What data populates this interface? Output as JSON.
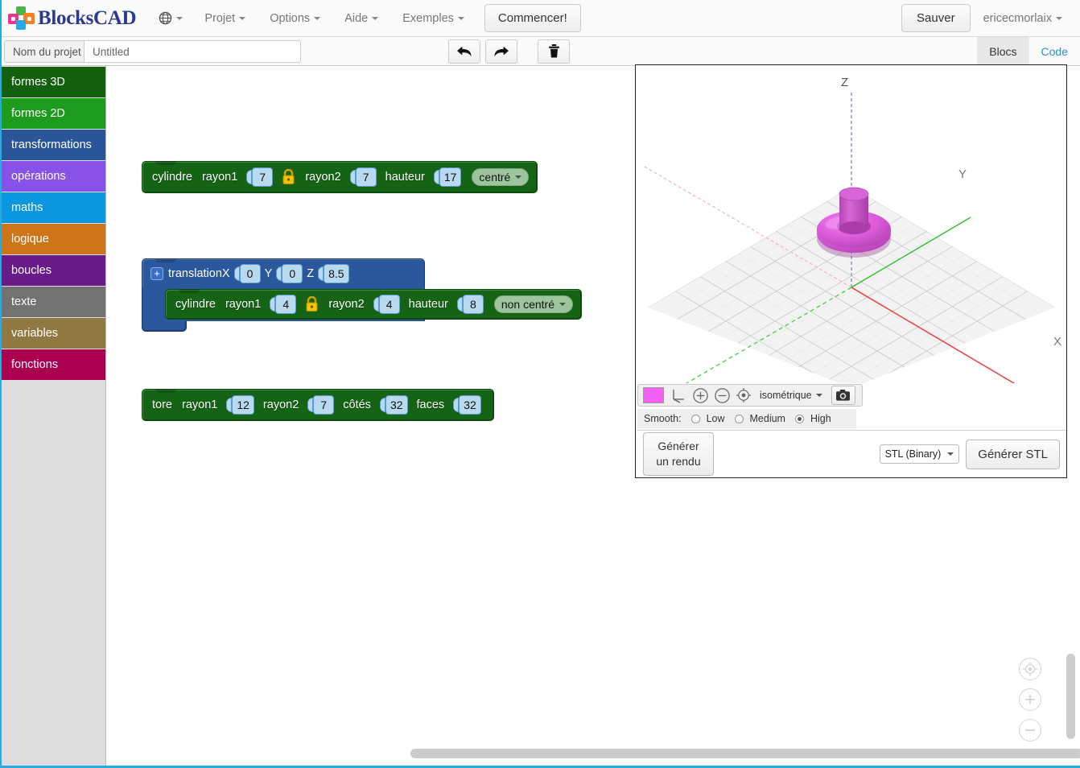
{
  "app": {
    "brand": "BlocksCAD",
    "logo_icon": "blockscad-logo-icon"
  },
  "navbar": {
    "language_icon": "globe-icon",
    "menus": [
      {
        "label": "Projet",
        "icon": "chevron-down-icon"
      },
      {
        "label": "Options",
        "icon": "chevron-down-icon"
      },
      {
        "label": "Aide",
        "icon": "chevron-down-icon"
      },
      {
        "label": "Exemples",
        "icon": "chevron-down-icon"
      }
    ],
    "start_button": "Commencer!",
    "save_button": "Sauver",
    "user": "ericecmorlaix"
  },
  "subbar": {
    "project_label": "Nom du projet",
    "project_value": "Untitled",
    "project_placeholder": "Untitled",
    "undo_icon": "undo-arrow-icon",
    "redo_icon": "redo-arrow-icon",
    "trash_icon": "trash-icon",
    "tabs": [
      {
        "label": "Blocs",
        "active": true
      },
      {
        "label": "Code",
        "active": false
      }
    ]
  },
  "toolbox": {
    "categories": [
      {
        "label": "formes 3D",
        "color": "#13610f"
      },
      {
        "label": "formes 2D",
        "color": "#1d9b1d"
      },
      {
        "label": "transformations",
        "color": "#2a5699"
      },
      {
        "label": "opérations",
        "color": "#8852e8"
      },
      {
        "label": "maths",
        "color": "#0b96e0"
      },
      {
        "label": "logique",
        "color": "#cc7519"
      },
      {
        "label": "boucles",
        "color": "#6a1b8a"
      },
      {
        "label": "texte",
        "color": "#727272"
      },
      {
        "label": "variables",
        "color": "#8f7841"
      },
      {
        "label": "fonctions",
        "color": "#ab0050"
      }
    ]
  },
  "workspace": {
    "blocks": [
      {
        "type": "cylindre",
        "name": "cylinder-block-1",
        "label": "cylindre",
        "lock_icon": "padlock-icon",
        "fields": [
          {
            "label": "rayon1",
            "value": "7"
          },
          {
            "label": "rayon2",
            "value": "7"
          },
          {
            "label": "hauteur",
            "value": "17"
          }
        ],
        "dropdown": "centré"
      },
      {
        "type": "translation",
        "name": "translation-block",
        "label": "translation",
        "expand_icon": "plus-icon",
        "fields": [
          {
            "label": "X",
            "value": "0"
          },
          {
            "label": "Y",
            "value": "0"
          },
          {
            "label": "Z",
            "value": "8.5"
          }
        ],
        "child": {
          "type": "cylindre",
          "name": "cylinder-block-2",
          "label": "cylindre",
          "lock_icon": "padlock-icon",
          "fields": [
            {
              "label": "rayon1",
              "value": "4"
            },
            {
              "label": "rayon2",
              "value": "4"
            },
            {
              "label": "hauteur",
              "value": "8"
            }
          ],
          "dropdown": "non centré"
        }
      },
      {
        "type": "tore",
        "name": "torus-block",
        "label": "tore",
        "fields": [
          {
            "label": "rayon1",
            "value": "12"
          },
          {
            "label": "rayon2",
            "value": "7"
          },
          {
            "label": "côtés",
            "value": "32"
          },
          {
            "label": "faces",
            "value": "32"
          }
        ]
      }
    ],
    "zoom_controls": [
      {
        "name": "workspace-center-icon",
        "icon": "crosshair-icon"
      },
      {
        "name": "workspace-zoom-in-icon",
        "icon": "plus-circle-icon"
      },
      {
        "name": "workspace-zoom-out-icon",
        "icon": "minus-circle-icon"
      }
    ]
  },
  "viewer": {
    "axes": {
      "z": "Z",
      "y": "Y",
      "x": "X"
    },
    "object_color": "#e15fe0",
    "grid_color": "#d8d8d8",
    "axis_colors": {
      "x": "#e03030",
      "y": "#23b023",
      "z": "#8a8ab0"
    },
    "toolbar": {
      "color_swatch": "#f45ff4",
      "color_swatch_name": "color-swatch",
      "axes_icon": "axes-icon",
      "zoom_in_icon": "zoom-in-icon",
      "zoom_out_icon": "zoom-out-icon",
      "center_icon": "recenter-icon",
      "view_select": "isométrique",
      "camera_icon": "camera-icon"
    },
    "smooth": {
      "label": "Smooth:",
      "options": [
        {
          "label": "Low",
          "selected": false
        },
        {
          "label": "Medium",
          "selected": false
        },
        {
          "label": "High",
          "selected": true
        }
      ]
    },
    "render_button": "Générer un rendu",
    "format_select": "STL (Binary)",
    "export_button": "Générer STL"
  }
}
